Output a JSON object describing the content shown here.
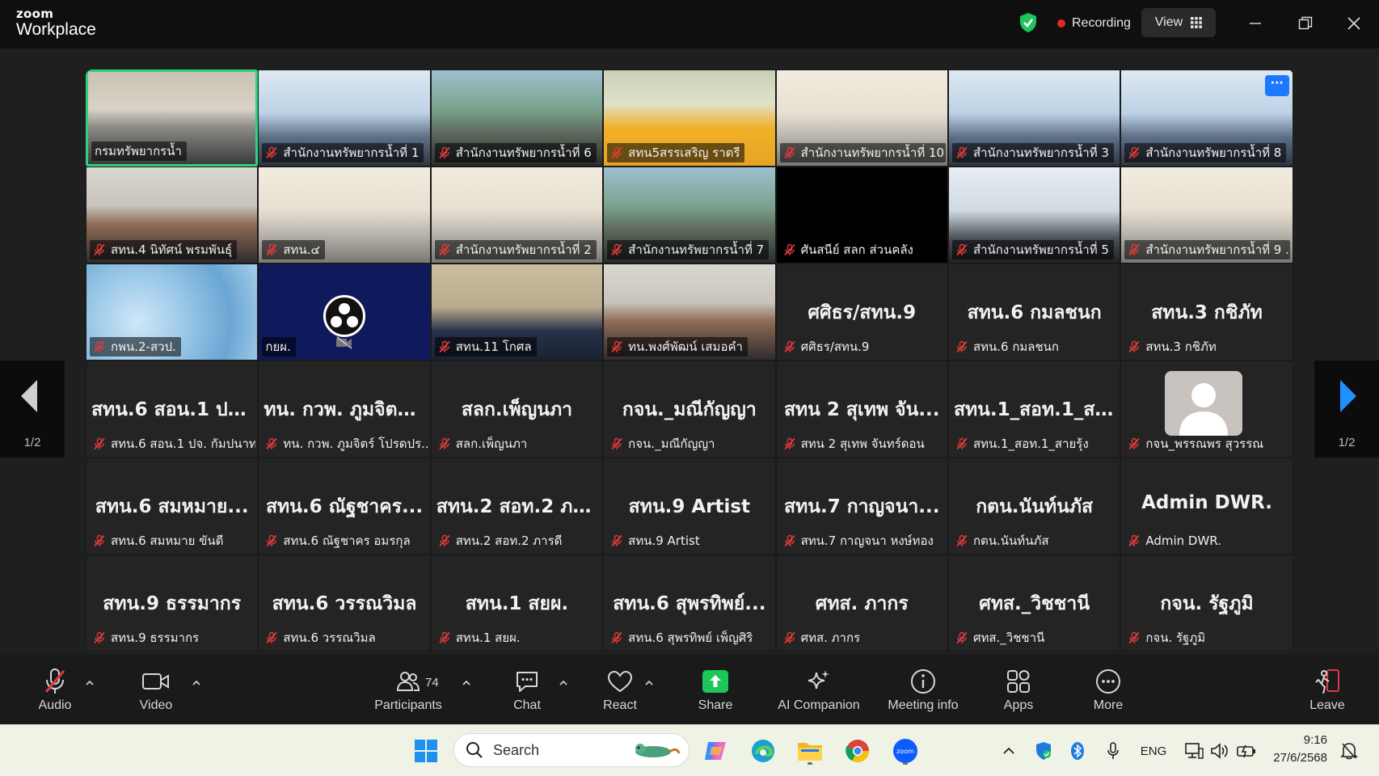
{
  "app": {
    "logo_line1": "zoom",
    "logo_line2": "Workplace",
    "recording_label": "Recording",
    "view_label": "View"
  },
  "colors": {
    "accent": "#2fd07e",
    "recording": "#e02828",
    "share": "#1cc65b",
    "mic_off": "#e03a3a",
    "more_button": "#1e78ff"
  },
  "pager": {
    "left": "1/2",
    "right": "1/2"
  },
  "tiles": [
    {
      "label": "กรมทรัพยากรน้ำ",
      "big": "",
      "look": "vid-room",
      "muted": false,
      "speaking": true
    },
    {
      "label": "สำนักงานทรัพยากรน้ำที่ 1",
      "big": "",
      "look": "vid-blue",
      "muted": true
    },
    {
      "label": "สำนักงานทรัพยากรน้ำที่ 6",
      "big": "",
      "look": "vid-green",
      "muted": true
    },
    {
      "label": "สทน5สรรเสริญ ราตรี",
      "big": "",
      "look": "vid-person",
      "muted": true
    },
    {
      "label": "สำนักงานทรัพยากรน้ำที่ 10",
      "big": "",
      "look": "vid-office",
      "muted": true
    },
    {
      "label": "สำนักงานทรัพยากรน้ำที่ 3",
      "big": "",
      "look": "vid-blue",
      "muted": true
    },
    {
      "label": "สำนักงานทรัพยากรน้ำที่ 8",
      "big": "",
      "look": "vid-blue",
      "muted": true,
      "more": true
    },
    {
      "label": "สทน.4 นิทัศน์ พรมพันธุ์",
      "big": "",
      "look": "vid-face",
      "muted": true
    },
    {
      "label": "สทน.๔",
      "big": "",
      "look": "vid-office",
      "muted": true
    },
    {
      "label": "สำนักงานทรัพยากรน้ำที่ 2",
      "big": "",
      "look": "vid-office",
      "muted": true
    },
    {
      "label": "สำนักงานทรัพยากรน้ำที่ 7",
      "big": "",
      "look": "vid-green",
      "muted": true
    },
    {
      "label": "ศันสนีย์ สลก ส่วนคลัง",
      "big": "",
      "look": "vid-black",
      "muted": true
    },
    {
      "label": "สำนักงานทรัพยากรน้ำที่ 5",
      "big": "",
      "look": "vid-dark",
      "muted": true
    },
    {
      "label": "สำนักงานทรัพยากรน้ำที่ 9 ...",
      "big": "",
      "look": "vid-office",
      "muted": true
    },
    {
      "label": "กพน.2-สวป.",
      "big": "",
      "look": "vid-bokeh",
      "muted": true
    },
    {
      "label": "กยผ.",
      "big": "",
      "look": "vid-obs",
      "muted": false,
      "obs": true
    },
    {
      "label": "สทน.11 โกศล",
      "big": "",
      "look": "vid-man",
      "muted": true
    },
    {
      "label": "ทน.พงศ์พัฒน์ เสมอคำ",
      "big": "",
      "look": "vid-face",
      "muted": true
    },
    {
      "label": "ศศิธร/สทน.9",
      "big": "ศศิธร/สทน.9",
      "look": "",
      "muted": true
    },
    {
      "label": "สทน.6 กมลชนก",
      "big": "สทน.6 กมลชนก",
      "look": "",
      "muted": true
    },
    {
      "label": "สทน.3 กชิภัท",
      "big": "สทน.3 กชิภัท",
      "look": "",
      "muted": true
    },
    {
      "label": "สทน.6 สอน.1 ปจ. กัมปนาท",
      "big": "สทน.6 สอน.1 ปจ...",
      "look": "",
      "muted": true
    },
    {
      "label": "ทน. กวพ. ภูมจิตร์ โปรดปร...",
      "big": "ทน. กวพ. ภูมจิตร์...",
      "look": "",
      "muted": true
    },
    {
      "label": "สลก.เพ็ญนภา",
      "big": "สลก.เพ็ญนภา",
      "look": "",
      "muted": true
    },
    {
      "label": "กจน._มณีกัญญา",
      "big": "กจน._มณีกัญญา",
      "look": "",
      "muted": true
    },
    {
      "label": "สทน 2 สุเทพ จันทร์ดอน",
      "big": "สทน 2 สุเทพ จัน...",
      "look": "",
      "muted": true
    },
    {
      "label": "สทน.1_สอท.1_สายรุ้ง",
      "big": "สทน.1_สอท.1_สา...",
      "look": "",
      "muted": true
    },
    {
      "label": "กจน_พรรณพร สุวรรณ",
      "big": "",
      "look": "",
      "muted": true,
      "avatar": true
    },
    {
      "label": "สทน.6 สมหมาย ขันตี",
      "big": "สทน.6 สมหมาย...",
      "look": "",
      "muted": true
    },
    {
      "label": "สทน.6 ณัฐชาคร อมรกุล",
      "big": "สทน.6 ณัฐชาคร...",
      "look": "",
      "muted": true
    },
    {
      "label": "สทน.2 สอท.2 ภารดี",
      "big": "สทน.2 สอท.2 ภารดี",
      "look": "",
      "muted": true
    },
    {
      "label": "สทน.9 Artist",
      "big": "สทน.9 Artist",
      "look": "",
      "muted": true
    },
    {
      "label": "สทน.7 กาญจนา หงษ์ทอง",
      "big": "สทน.7 กาญจนา...",
      "look": "",
      "muted": true
    },
    {
      "label": "กตน.นันท์นภัส",
      "big": "กตน.นันท์นภัส",
      "look": "",
      "muted": true
    },
    {
      "label": "Admin DWR.",
      "big": "Admin DWR.",
      "look": "",
      "muted": true
    },
    {
      "label": "สทน.9 ธรรมากร",
      "big": "สทน.9 ธรรมากร",
      "look": "",
      "muted": true
    },
    {
      "label": "สทน.6 วรรณวิมล",
      "big": "สทน.6 วรรณวิมล",
      "look": "",
      "muted": true
    },
    {
      "label": "สทน.1 สยผ.",
      "big": "สทน.1 สยผ.",
      "look": "",
      "muted": true
    },
    {
      "label": "สทน.6 สุพรทิพย์ เพ็ญศิริ",
      "big": "สทน.6 สุพรทิพย์...",
      "look": "",
      "muted": true
    },
    {
      "label": "ศทส. ภากร",
      "big": "ศทส. ภากร",
      "look": "",
      "muted": true
    },
    {
      "label": "ศทส._วิชชานี",
      "big": "ศทส._วิชชานี",
      "look": "",
      "muted": true
    },
    {
      "label": "กจน. รัฐภูมิ",
      "big": "กจน. รัฐภูมิ",
      "look": "",
      "muted": true
    }
  ],
  "toolbar": {
    "audio": "Audio",
    "video": "Video",
    "participants": "Participants",
    "participants_count": "74",
    "chat": "Chat",
    "react": "React",
    "share": "Share",
    "ai_companion": "AI Companion",
    "meeting_info": "Meeting info",
    "apps": "Apps",
    "more": "More",
    "leave": "Leave"
  },
  "taskbar": {
    "search_placeholder": "Search",
    "lang": "ENG",
    "time": "9:16",
    "date": "27/6/2568"
  }
}
